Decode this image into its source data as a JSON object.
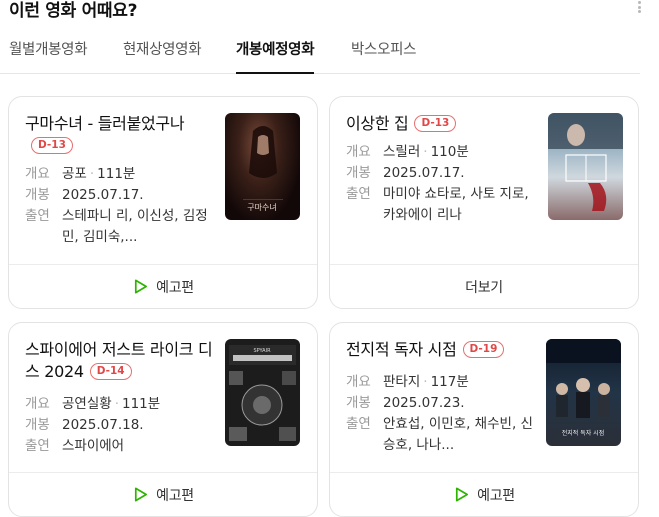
{
  "header": {
    "title": "이런 영화 어때요?"
  },
  "tabs": [
    {
      "label": "월별개봉영화"
    },
    {
      "label": "현재상영영화"
    },
    {
      "label": "개봉예정영화"
    },
    {
      "label": "박스오피스"
    }
  ],
  "active_tab": "개봉예정영화",
  "labels": {
    "genre": "개요",
    "release": "개봉",
    "cast": "출연"
  },
  "cards": [
    {
      "title": "구마수녀 - 들러붙었구나",
      "badge": "D-13",
      "genre": "공포",
      "runtime": "111분",
      "release": "2025.07.17.",
      "cast": "스테파니 리, 이신성, 김정민, 김미숙,...",
      "poster_text": "구마수녀",
      "footer": "예고편"
    },
    {
      "title": "이상한 집",
      "badge": "D-13",
      "genre": "스릴러",
      "runtime": "110분",
      "release": "2025.07.17.",
      "cast": "마미야 쇼타로, 사토 지로, 카와에이 리나",
      "footer": "더보기"
    },
    {
      "title": "스파이에어 저스트 라이크 디스 2024",
      "badge": "D-14",
      "genre": "공연실황",
      "runtime": "111분",
      "release": "2025.07.18.",
      "cast": "스파이에어",
      "poster_text": "SPYAIR",
      "footer": "예고편"
    },
    {
      "title": "전지적 독자 시점",
      "badge": "D-19",
      "genre": "판타지",
      "runtime": "117분",
      "release": "2025.07.23.",
      "cast": "안효섭, 이민호, 채수빈, 신승호, 나나...",
      "poster_text": "전지적 독자 시점",
      "footer": "예고편"
    }
  ],
  "colors": {
    "badge": "#e04848",
    "play_icon": "#2db400",
    "border": "#e3e3e3"
  }
}
